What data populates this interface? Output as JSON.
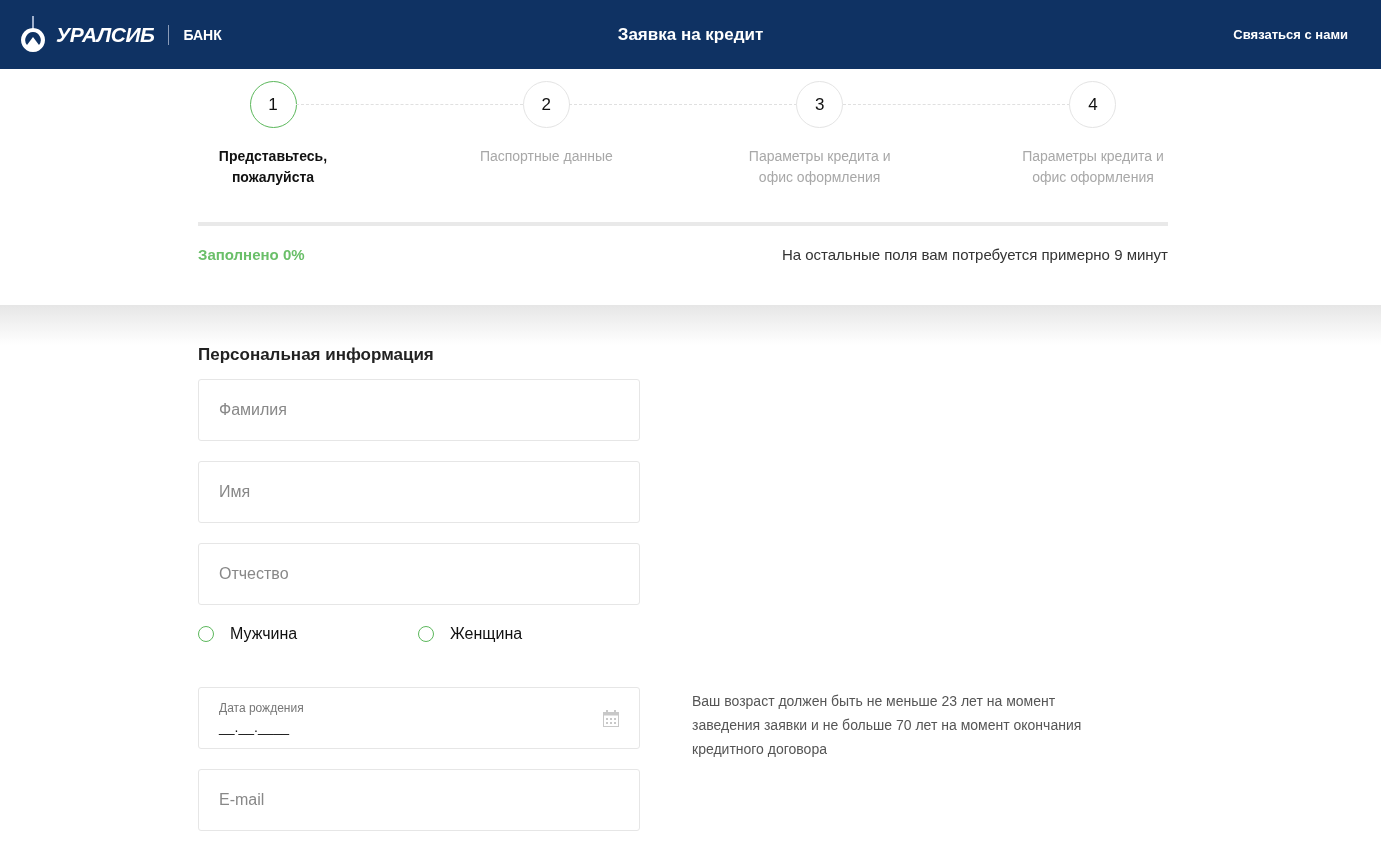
{
  "header": {
    "brand": "УРАЛСИБ",
    "brand_suffix": "БАНК",
    "title": "Заявка на кредит",
    "contact_link": "Связаться с нами"
  },
  "steps": [
    {
      "number": "1",
      "label": "Представьтесь, пожалуйста",
      "selected": true
    },
    {
      "number": "2",
      "label": "Паспортные данные",
      "selected": false
    },
    {
      "number": "3",
      "label": "Параметры кредита и офис оформления",
      "selected": false
    },
    {
      "number": "4",
      "label": "Параметры кредита и офис оформления",
      "selected": false
    }
  ],
  "progress": {
    "level": 0,
    "label": "Заполнено 0%",
    "time_hint": "На остальные поля вам потребуется примерно 9 минут"
  },
  "section_title": "Персональная информация",
  "name_fields": [
    {
      "placeholder": "Фамилия"
    },
    {
      "placeholder": "Имя"
    },
    {
      "placeholder": "Отчество"
    }
  ],
  "gender": [
    {
      "label": "Мужчина",
      "selected": false
    },
    {
      "label": "Женщина",
      "selected": false
    }
  ],
  "birth_date": {
    "label": "Дата рождения",
    "value": "__.__.____",
    "hint": "Ваш возраст должен быть не меньше 23 лет на момент заведения заявки и не больше 70 лет на момент окончания кредитного договора"
  },
  "email": {
    "placeholder": "E-mail"
  }
}
